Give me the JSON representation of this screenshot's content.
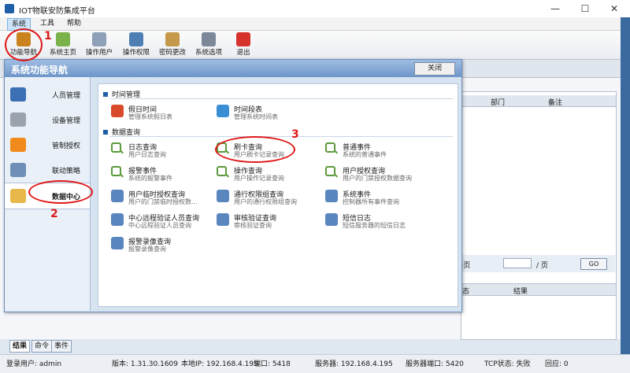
{
  "window": {
    "title": "IOT物联安防集成平台",
    "min": "—",
    "max": "☐",
    "close": "✕"
  },
  "menu": [
    {
      "label": "系统"
    },
    {
      "label": "工具"
    },
    {
      "label": "帮助"
    }
  ],
  "toolbar": [
    {
      "label": "功能导航",
      "icon": "gear-icon",
      "color": "#c9821e"
    },
    {
      "label": "系统主页",
      "icon": "flower-icon",
      "color": "#7bb24a"
    },
    {
      "label": "操作用户",
      "icon": "user-icon",
      "color": "#8ea1b8"
    },
    {
      "label": "操作权限",
      "icon": "computer-icon",
      "color": "#4d7fb3"
    },
    {
      "label": "密码更改",
      "icon": "key-icon",
      "color": "#c49a4a"
    },
    {
      "label": "系统选项",
      "icon": "tools-icon",
      "color": "#7d8898"
    },
    {
      "label": "退出",
      "icon": "power-icon",
      "color": "#d6312b"
    }
  ],
  "dialog": {
    "title": "系统功能导航",
    "close_label": "关闭",
    "nav": [
      {
        "label": "人员管理",
        "icon": "people-icon",
        "color": "#3d6fb4"
      },
      {
        "label": "设备管理",
        "icon": "device-icon",
        "color": "#9aa3ad"
      },
      {
        "label": "管制授权",
        "icon": "lock-icon",
        "color": "#f08a1c"
      },
      {
        "label": "联动策略",
        "icon": "network-icon",
        "color": "#6f8fb8"
      },
      {
        "label": "数据中心",
        "icon": "folder-search-icon",
        "color": "#e9b84a"
      }
    ],
    "sections": [
      {
        "title": "时间管理",
        "items": [
          {
            "name": "假日时间",
            "desc": "管理系统假日表",
            "icon": "calendar-icon",
            "color": "#d94a2a"
          },
          {
            "name": "时间段表",
            "desc": "管理系统时间表",
            "icon": "clock-icon",
            "color": "#3a8fd4"
          }
        ]
      },
      {
        "title": "数据查询",
        "items": [
          {
            "name": "日志查询",
            "desc": "用户日志查询",
            "icon": "magnifier-icon",
            "color": "#5b9a3a"
          },
          {
            "name": "刷卡查询",
            "desc": "用户刷卡记录查询",
            "icon": "magnifier-icon",
            "color": "#5b9a3a"
          },
          {
            "name": "普通事件",
            "desc": "系统的普通事件",
            "icon": "magnifier-icon",
            "color": "#5b9a3a"
          },
          {
            "name": "报警事件",
            "desc": "系统的报警事件",
            "icon": "magnifier-icon",
            "color": "#5b9a3a"
          },
          {
            "name": "操作查询",
            "desc": "用户操作记录查询",
            "icon": "magnifier-icon",
            "color": "#5b9a3a"
          },
          {
            "name": "用户授权查询",
            "desc": "用户的门禁授权数据查询",
            "icon": "magnifier-icon",
            "color": "#5b9a3a"
          },
          {
            "name": "用户临时授权查询",
            "desc": "用户的门禁临时授权数...",
            "icon": "grid-icon",
            "color": "#5a86c0"
          },
          {
            "name": "通行权限组查询",
            "desc": "用户的通行权限组查询",
            "icon": "grid-icon",
            "color": "#5a86c0"
          },
          {
            "name": "系统事件",
            "desc": "控制器所有事件查询",
            "icon": "grid-icon",
            "color": "#5a86c0"
          },
          {
            "name": "中心远程验证人员查询",
            "desc": "中心远程验证人员查询",
            "icon": "grid-icon",
            "color": "#5a86c0"
          },
          {
            "name": "审核验证查询",
            "desc": "审核验证查询",
            "icon": "grid-icon",
            "color": "#5a86c0"
          },
          {
            "name": "短信日志",
            "desc": "短信服务器的短信日志",
            "icon": "grid-icon",
            "color": "#5a86c0"
          },
          {
            "name": "报警录像查询",
            "desc": "报警录像查询",
            "icon": "grid-icon",
            "color": "#5a86c0"
          }
        ]
      }
    ]
  },
  "background": {
    "table_headers": [
      "部门",
      "备注"
    ],
    "pager_label": "-页",
    "pager_input": "",
    "pager_suffix": "/ 页",
    "go_label": "GO",
    "lower_headers": [
      "状态",
      "结果"
    ]
  },
  "annotations": [
    "1",
    "2",
    "3"
  ],
  "bottom_tabs": [
    {
      "label": "结果"
    },
    {
      "label": "命令"
    },
    {
      "label": "事件"
    }
  ],
  "status": {
    "user_label": "登录用户: admin",
    "version": "版本: 1.31.30.1609",
    "local_ip": "本地IP: 192.168.4.195",
    "port": "端口: 5418",
    "server": "服务器: 192.168.4.195",
    "server_port": "服务器端口: 5420",
    "tcp": "TCP状态: 失败",
    "echo": "回应: 0"
  }
}
